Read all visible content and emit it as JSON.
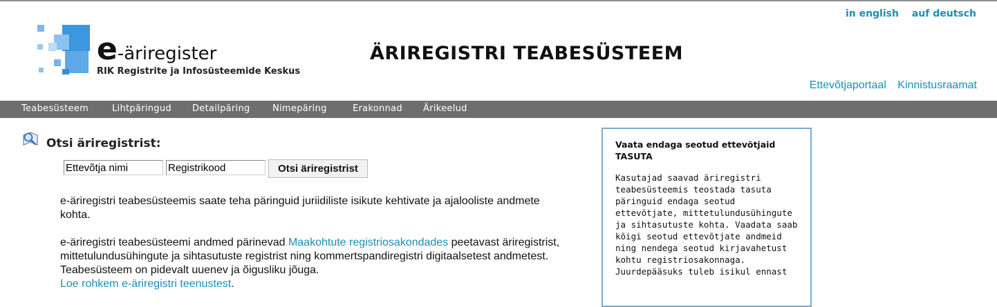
{
  "header": {
    "logo_e": "e",
    "logo_rest": "-äriregister",
    "logo_subtitle": "RIK Registrite ja Infosüsteemide Keskus",
    "site_title": "ÄRIREGISTRI TEABESÜSTEEM",
    "lang_english": "in english",
    "lang_deutsch": "auf deutsch",
    "portal_link_1": "Ettevõtjaportaal",
    "portal_link_2": "Kinnistusraamat"
  },
  "nav": {
    "items": [
      "Teabesüsteem",
      "Lihtpäringud",
      "Detailpäring",
      "Nimepäring",
      "Erakonnad",
      "Ärikeelud"
    ]
  },
  "search": {
    "title": "Otsi äriregistrist:",
    "name_value": "Ettevõtja nimi",
    "code_value": "Registrikood",
    "button_label": "Otsi äriregistrist"
  },
  "content": {
    "p1": "e-äriregistri teabesüsteemis saate teha päringuid juriidiliste isikute kehtivate ja ajalooliste andmete kohta.",
    "p2_before": "e-äriregistri teabesüsteemi andmed pärinevad ",
    "p2_link": "Maakohtute registriosakondades",
    "p2_after": " peetavast äriregistrist, mittetulundusühingute ja sihtasutuste registrist ning kommertspandiregistri digitaalsetest andmetest. Teabesüsteem on pidevalt uuenev ja õigusliku jõuga.",
    "more_link": "Loe rohkem e-äriregistri teenustest",
    "more_after": "."
  },
  "infobox": {
    "title": "Vaata endaga seotud ettevõtjaid TASUTA",
    "text": "Kasutajad saavad äriregistri teabesüsteemis teostada tasuta päringuid endaga seotud ettevõtjate, mittetulundusühingute ja sihtasutuste kohta. Vaadata saab kõigi seotud ettevõtjate andmeid ning nendega seotud kirjavahetust kohtu registriosakonnaga. Juurdepääsuks tuleb isikul ennast"
  },
  "colors": {
    "link": "#1a8fb5",
    "navbar": "#6e6e6e",
    "infobox_border": "#7aa9cc",
    "logo_blue": "#2f8fdc"
  },
  "icons": {
    "search": "magnifier-book-icon",
    "logo": "blue-squares-logo"
  }
}
